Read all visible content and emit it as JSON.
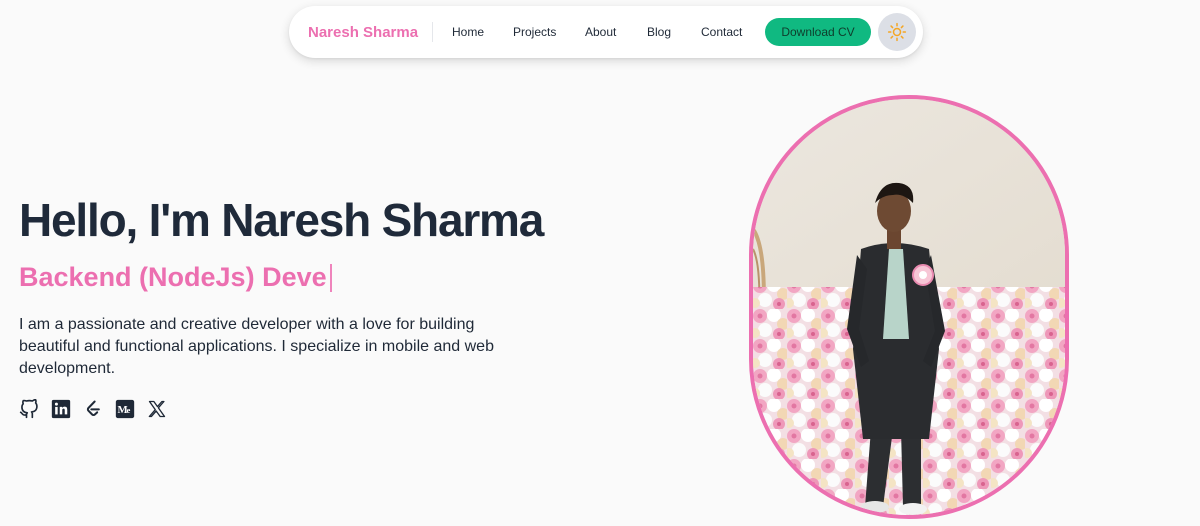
{
  "nav": {
    "brand": "Naresh Sharma",
    "links": [
      "Home",
      "Projects",
      "About",
      "Blog",
      "Contact"
    ],
    "cta_label": "Download CV",
    "theme_icon": "sun-icon"
  },
  "hero": {
    "title": "Hello, I'm Naresh Sharma",
    "role_typed": "Backend (NodeJs) Deve",
    "description": "I am a passionate and creative developer with a love for building beautiful and functional applications. I specialize in mobile and web development.",
    "socials": [
      "github-icon",
      "linkedin-icon",
      "leetcode-icon",
      "medium-icon",
      "x-icon"
    ]
  },
  "portrait": {
    "icon": "profile-photo"
  },
  "colors": {
    "accent": "#ec6fb0",
    "button": "#10b981",
    "heading": "#1f2a3a",
    "background": "#fafafa"
  }
}
